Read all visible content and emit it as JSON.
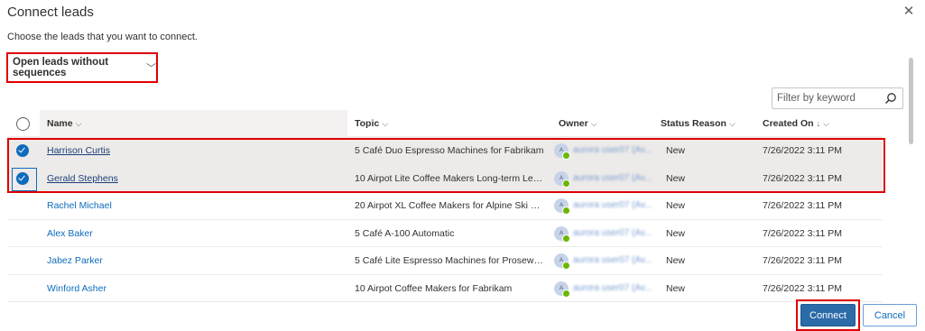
{
  "dialog": {
    "title": "Connect leads",
    "subtitle": "Choose the leads that you want to connect.",
    "close_icon": "close-icon"
  },
  "view_selector": {
    "label": "Open leads without sequences",
    "icon": "chevron-down-icon"
  },
  "filter": {
    "placeholder": "Filter by keyword",
    "icon": "search-icon"
  },
  "columns": {
    "name": "Name",
    "topic": "Topic",
    "owner": "Owner",
    "status": "Status Reason",
    "created": "Created On"
  },
  "rows": [
    {
      "name": "Harrison Curtis",
      "topic": "5 Café Duo Espresso Machines for Fabrikam",
      "owner_initial": "A",
      "owner": "aurora user07 (Av...",
      "status": "New",
      "created": "7/26/2022 3:11 PM",
      "selected": true
    },
    {
      "name": "Gerald Stephens",
      "topic": "10 Airpot Lite Coffee Makers Long-term Lea...",
      "owner_initial": "A",
      "owner": "aurora user07 (Av...",
      "status": "New",
      "created": "7/26/2022 3:11 PM",
      "selected": true
    },
    {
      "name": "Rachel Michael",
      "topic": "20 Airpot XL Coffee Makers for Alpine Ski H...",
      "owner_initial": "A",
      "owner": "aurora user07 (Av...",
      "status": "New",
      "created": "7/26/2022 3:11 PM",
      "selected": false
    },
    {
      "name": "Alex Baker",
      "topic": "5 Café A-100 Automatic",
      "owner_initial": "A",
      "owner": "aurora user07 (Av...",
      "status": "New",
      "created": "7/26/2022 3:11 PM",
      "selected": false
    },
    {
      "name": "Jabez Parker",
      "topic": "5 Café Lite Espresso Machines for Proseware",
      "owner_initial": "A",
      "owner": "aurora user07 (Av...",
      "status": "New",
      "created": "7/26/2022 3:11 PM",
      "selected": false
    },
    {
      "name": "Winford Asher",
      "topic": "10 Airpot Coffee Makers for Fabrikam",
      "owner_initial": "A",
      "owner": "aurora user07 (Av...",
      "status": "New",
      "created": "7/26/2022 3:11 PM",
      "selected": false
    }
  ],
  "buttons": {
    "connect": "Connect",
    "cancel": "Cancel"
  },
  "colors": {
    "accent": "#0f6cbd",
    "primary_button": "#2b6ba8",
    "highlight": "#e00000",
    "presence": "#6bb700"
  }
}
